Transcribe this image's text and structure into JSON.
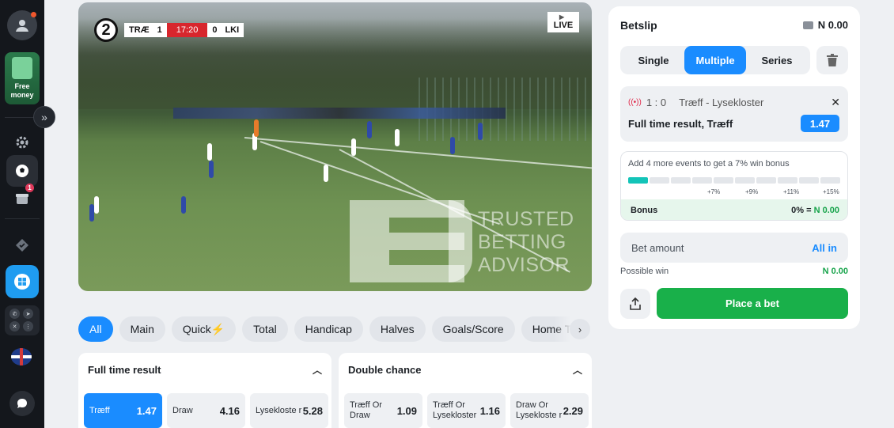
{
  "sidebar": {
    "free_money_label": "Free money",
    "gift_badge": "1",
    "icons": [
      "user-icon",
      "gift-box-icon",
      "expand-icon",
      "settings-icon",
      "soccer-ball-icon",
      "gift-icon",
      "promo-icon",
      "windows-icon",
      "whatsapp-icon",
      "telegram-icon",
      "x-icon",
      "more-icon",
      "uk-flag-icon",
      "chat-icon"
    ]
  },
  "video": {
    "home_team": "TRÆ",
    "home_score": "1",
    "clock": "17:20",
    "away_score": "0",
    "away_team": "LKI",
    "channel_logo": "2",
    "live_label": "LIVE",
    "watermark": [
      "TRUSTED",
      "BETTING",
      "ADVISOR"
    ]
  },
  "filters": {
    "tabs": [
      "All",
      "Main",
      "Quick⚡",
      "Total",
      "Handicap",
      "Halves",
      "Goals/Score",
      "Home Tea"
    ]
  },
  "markets": [
    {
      "title": "Full time result",
      "odds": [
        {
          "name": "Træff",
          "value": "1.47"
        },
        {
          "name": "Draw",
          "value": "4.16"
        },
        {
          "name": "Lysekloste r",
          "value": "5.28"
        }
      ]
    },
    {
      "title": "Double chance",
      "odds": [
        {
          "name": "Træff Or Draw",
          "value": "1.09"
        },
        {
          "name": "Træff Or Lysekloster",
          "value": "1.16"
        },
        {
          "name": "Draw Or Lysekloste r",
          "value": "2.29"
        }
      ]
    }
  ],
  "betslip": {
    "title": "Betslip",
    "balance": "N 0.00",
    "types": [
      "Single",
      "Multiple",
      "Series"
    ],
    "active_type": "Multiple",
    "event": {
      "score": "1 : 0",
      "teams": "Træff - Lysekloster",
      "market": "Full time result, Træff",
      "odd": "1.47"
    },
    "bonus": {
      "text": "Add 4 more events to get a 7% win bonus",
      "ticks": [
        "+7%",
        "+9%",
        "+11%",
        "+15%"
      ],
      "progress_fraction": 0.1,
      "label": "Bonus",
      "percent": "0% =",
      "amount": "N 0.00"
    },
    "bet_amount_placeholder": "Bet amount",
    "all_in_label": "All in",
    "possible_win_label": "Possible win",
    "possible_win_value": "N 0.00",
    "place_bet_label": "Place a bet"
  },
  "colors": {
    "accent": "#1a8cff",
    "success": "#19b04a",
    "rail": "#14171c",
    "live_red": "#d8262d"
  }
}
